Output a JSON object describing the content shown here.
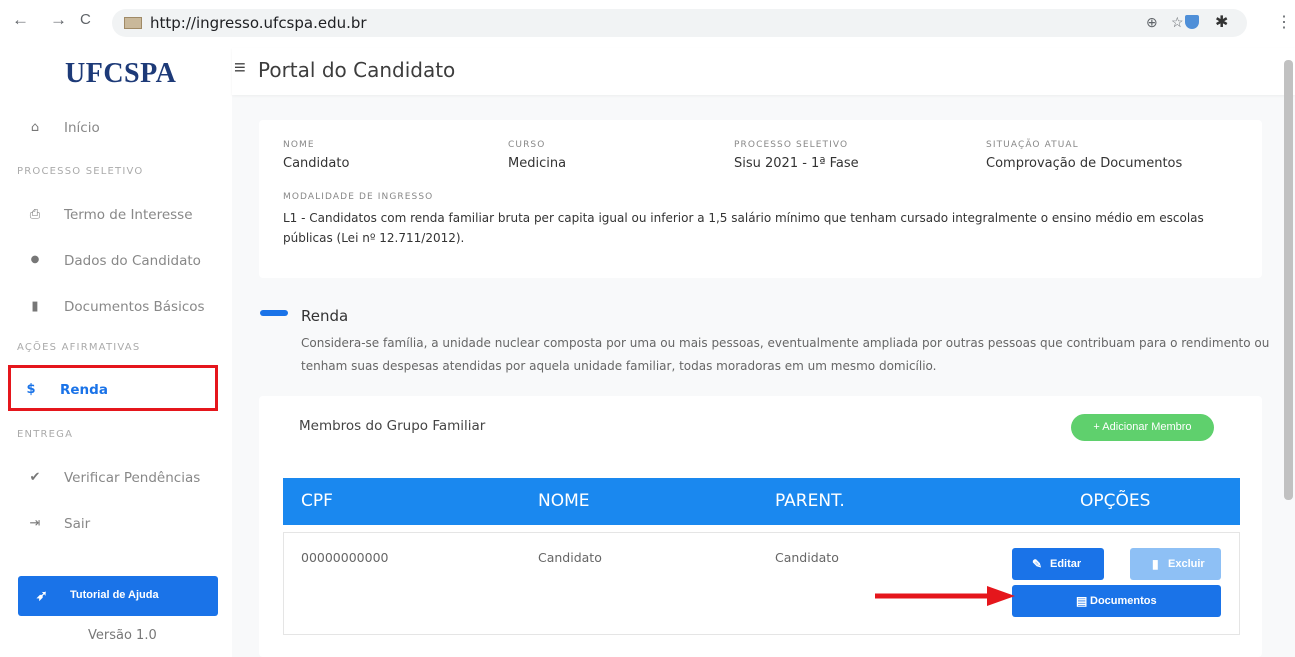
{
  "browser": {
    "url": "http://ingresso.ufcspa.edu.br",
    "nav_back": "←",
    "nav_forward": "→",
    "nav_reload": "C",
    "zoom_glyph": "⊕",
    "star_glyph": "☆",
    "puzzle_glyph": "✱",
    "menu_glyph": "⋮"
  },
  "sidebar": {
    "logo": "UFCSPA",
    "home": {
      "label": "Início",
      "icon": "home-icon",
      "glyph": "⌂"
    },
    "section_processo": "PROCESSO SELETIVO",
    "termo": {
      "label": "Termo de Interesse",
      "icon": "printer-icon",
      "glyph": "⎙"
    },
    "dados": {
      "label": "Dados do Candidato",
      "icon": "user-icon",
      "glyph": "●"
    },
    "documentos": {
      "label": "Documentos Básicos",
      "icon": "file-icon",
      "glyph": "▮"
    },
    "section_acoes": "AÇÕES AFIRMATIVAS",
    "renda": {
      "label": "Renda",
      "icon": "dollar-icon",
      "glyph": "$"
    },
    "section_entrega": "ENTREGA",
    "verificar": {
      "label": "Verificar Pendências",
      "icon": "check-icon",
      "glyph": "✔"
    },
    "sair": {
      "label": "Sair",
      "icon": "logout-icon",
      "glyph": "⇥"
    },
    "help_button": {
      "label": "Tutorial de Ajuda",
      "icon": "rocket-icon",
      "glyph": "➶"
    },
    "version": "Versão 1.0"
  },
  "header": {
    "menu_glyph": "≡",
    "title": "Portal do Candidato"
  },
  "info": {
    "nome_label": "NOME",
    "nome_value": "Candidato",
    "curso_label": "CURSO",
    "curso_value": "Medicina",
    "processo_label": "PROCESSO SELETIVO",
    "processo_value": "Sisu 2021 - 1ª Fase",
    "situacao_label": "SITUAÇÃO ATUAL",
    "situacao_value": "Comprovação de Documentos",
    "modalidade_label": "MODALIDADE DE INGRESSO",
    "modalidade_value": "L1 - Candidatos com renda familiar bruta per capita igual ou inferior a 1,5 salário mínimo que tenham cursado integralmente o ensino médio em escolas públicas (Lei nº 12.711/2012)."
  },
  "renda": {
    "title": "Renda",
    "description": "Considera-se família, a unidade nuclear composta por uma ou mais pessoas, eventualmente ampliada por outras pessoas que contribuam para o rendimento ou tenham suas despesas atendidas por aquela unidade familiar, todas moradoras em um mesmo domicílio."
  },
  "members": {
    "title": "Membros do Grupo Familiar",
    "add_label": "+ Adicionar Membro",
    "columns": [
      "CPF",
      "NOME",
      "PARENT.",
      "OPÇÕES"
    ],
    "rows": [
      {
        "cpf": "00000000000",
        "nome": "Candidato",
        "parentesco": "Candidato"
      }
    ],
    "edit_label": "Editar",
    "edit_glyph": "✎",
    "delete_label": "Excluir",
    "delete_glyph": "▮",
    "docs_label": "Documentos",
    "docs_glyph": "▤"
  },
  "colors": {
    "primary": "#1a73e8",
    "table_header": "#1a88ef",
    "add_button": "#5fd06d",
    "highlight": "#e5161c",
    "annotation_arrow": "#e5161c"
  }
}
